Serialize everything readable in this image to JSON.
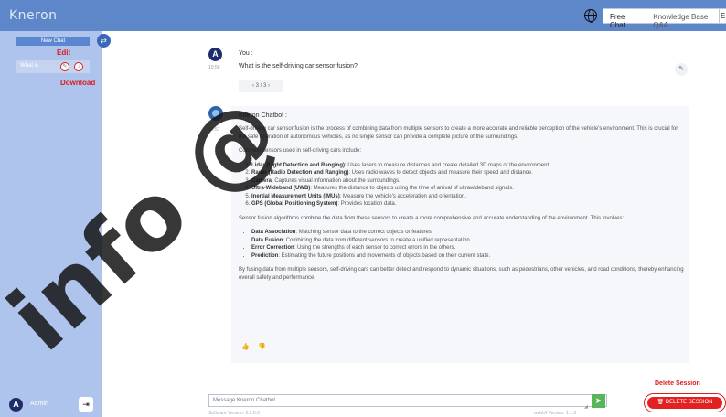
{
  "app": {
    "logo": "Kneron"
  },
  "header": {
    "tabs": [
      "Free Chat",
      "Knowledge Base Q&A"
    ],
    "extra": "E"
  },
  "sidebar": {
    "new_chat": "New Chat",
    "chat_item": "What is",
    "annotations": {
      "edit": "Edit",
      "download": "Download"
    },
    "user_initial": "A",
    "user_name": "Admin"
  },
  "conversation": {
    "user": {
      "initial": "A",
      "name": "You :",
      "time": "10:56",
      "text": "What is the self-driving car sensor fusion?",
      "pager": "‹ 3 / 3 ›"
    },
    "bot": {
      "name": "Kneron Chatbot :",
      "time": "10:57",
      "intro": "Self-driving car sensor fusion is the process of combining data from multiple sensors to create a more accurate and reliable perception of the vehicle's environment. This is crucial for the safe operation of autonomous vehicles, as no single sensor can provide a complete picture of the surroundings.",
      "sensors_heading": "Common sensors used in self-driving cars include:",
      "sensors": [
        {
          "name": "Lidar (Light Detection and Ranging)",
          "desc": ": Uses lasers to measure distances and create detailed 3D maps of the environment."
        },
        {
          "name": "Radar (Radio Detection and Ranging)",
          "desc": ": Uses radio waves to detect objects and measure their speed and distance."
        },
        {
          "name": "Camera",
          "desc": ": Captures visual information about the surroundings."
        },
        {
          "name": "Ultra-Wideband (UWB)",
          "desc": ": Measures the distance to objects using the time of arrival of ultrawideband signals."
        },
        {
          "name": "Inertial Measurement Units (IMUs)",
          "desc": ": Measure the vehicle's acceleration and orientation."
        },
        {
          "name": "GPS (Global Positioning System)",
          "desc": ": Provides location data."
        }
      ],
      "fusion_heading": "Sensor fusion algorithms combine the data from these sensors to create a more comprehensive and accurate understanding of the environment. This involves:",
      "steps": [
        {
          "name": "Data Association",
          "desc": ": Matching sensor data to the correct objects or features."
        },
        {
          "name": "Data Fusion",
          "desc": ": Combining the data from different sensors to create a unified representation."
        },
        {
          "name": "Error Correction",
          "desc": ": Using the strengths of each sensor to correct errors in the others."
        },
        {
          "name": "Prediction",
          "desc": ": Estimating the future positions and movements of objects based on their current state."
        }
      ],
      "conclusion": "By fusing data from multiple sensors, self-driving cars can better detect and respond to dynamic situations, such as pedestrians, other vehicles, and road conditions, thereby enhancing overall safety and performance."
    }
  },
  "composer": {
    "placeholder": "Message Kneron Chatbot",
    "software_version": "Software Version: 0.2.0.0",
    "webui_version": "webUI Version: 1.1.0"
  },
  "delete": {
    "annotation": "Delete Session",
    "button": "DELETE SESSION"
  },
  "watermark": "info @"
}
